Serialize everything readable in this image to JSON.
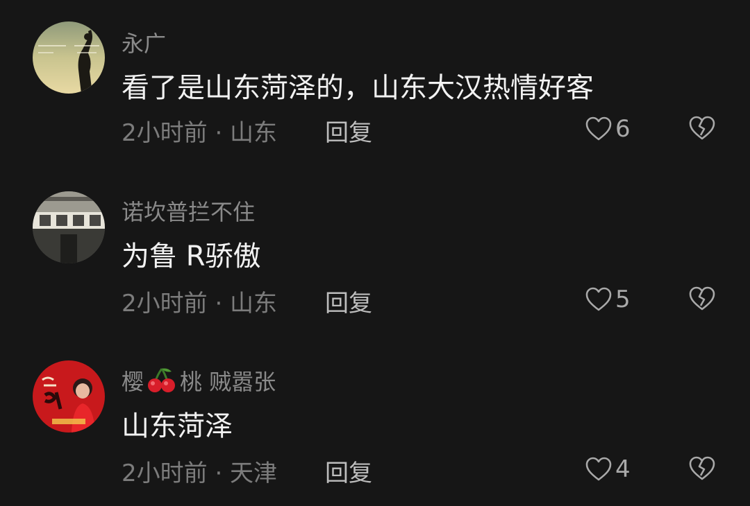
{
  "comments": [
    {
      "username": "永广",
      "content": "看了是山东菏泽的，山东大汉热情好客",
      "time_location": "2小时前 · 山东",
      "reply_label": "回复",
      "likes": "6",
      "avatar_icon": "sunset-silhouette-avatar"
    },
    {
      "username": "诺坎普拦不住",
      "content": "为鲁 R骄傲",
      "time_location": "2小时前 · 山东",
      "reply_label": "回复",
      "likes": "5",
      "avatar_icon": "street-storefront-avatar"
    },
    {
      "username_prefix": "樱",
      "username_emoji": "cherry-emoji",
      "username_suffix": "桃 贼嚣张",
      "content": "山东菏泽",
      "time_location": "2小时前 · 天津",
      "reply_label": "回复",
      "likes": "4",
      "avatar_icon": "red-portrait-avatar"
    }
  ],
  "colors": {
    "background": "#161616",
    "text_primary": "#f2f2f2",
    "text_secondary": "#8a8a8a",
    "icon": "#a9a9a9"
  }
}
